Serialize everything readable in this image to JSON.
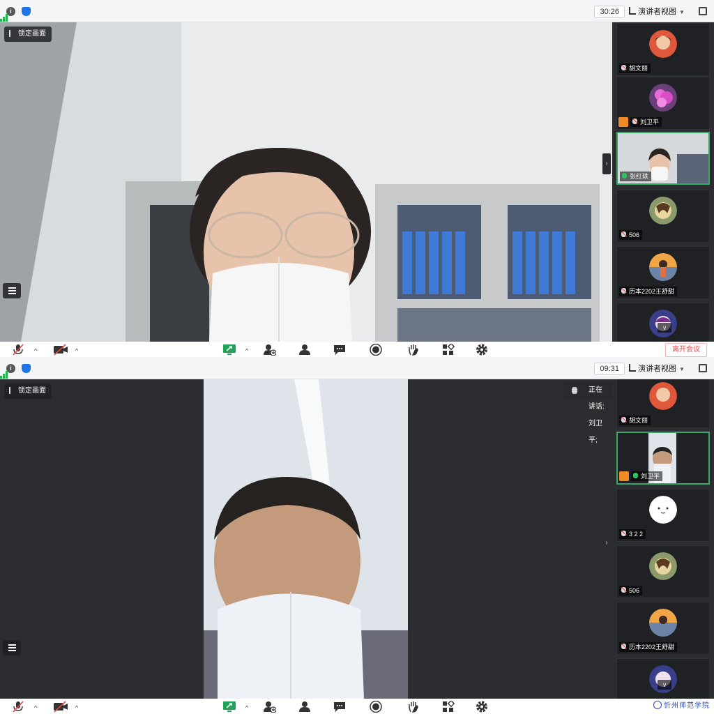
{
  "screens": [
    {
      "timer": "30:26",
      "view_mode": "演讲者视图",
      "lock_label": "锁定画面",
      "participants": [
        {
          "name": "胡文丽",
          "mic": "muted",
          "host": false,
          "active": false
        },
        {
          "name": "刘卫平",
          "mic": "muted",
          "host": true,
          "active": false
        },
        {
          "name": "张红轶",
          "mic": "on",
          "host": false,
          "active": true
        },
        {
          "name": "506",
          "mic": "muted",
          "host": false,
          "active": false
        },
        {
          "name": "历本2202王舒甜",
          "mic": "muted",
          "host": false,
          "active": false
        }
      ]
    },
    {
      "timer": "09:31",
      "view_mode": "演讲者视图",
      "lock_label": "锁定画面",
      "speaking_label": "正在讲话: 刘卫平;",
      "participants": [
        {
          "name": "胡文丽",
          "mic": "muted",
          "host": false,
          "active": false
        },
        {
          "name": "刘卫平",
          "mic": "on",
          "host": true,
          "active": true
        },
        {
          "name": "3 2 2",
          "mic": "muted",
          "host": false,
          "active": false
        },
        {
          "name": "506",
          "mic": "muted",
          "host": false,
          "active": false
        },
        {
          "name": "历本2202王舒甜",
          "mic": "muted",
          "host": false,
          "active": false
        }
      ]
    }
  ],
  "toolbar": {
    "leave_label": "离开会议",
    "icons": [
      "mic-icon",
      "camera-off-icon",
      "share-screen-icon",
      "invite-icon",
      "participants-icon",
      "chat-icon",
      "record-icon",
      "raise-hand-icon",
      "apps-icon",
      "settings-icon"
    ]
  },
  "watermark": "忻州师范学院",
  "colors": {
    "accent_green": "#3aa767",
    "sidebar_bg": "#2b2d30",
    "leave_red": "#e84a4a",
    "host_orange": "#f08a24",
    "share_green": "#21a35a"
  }
}
